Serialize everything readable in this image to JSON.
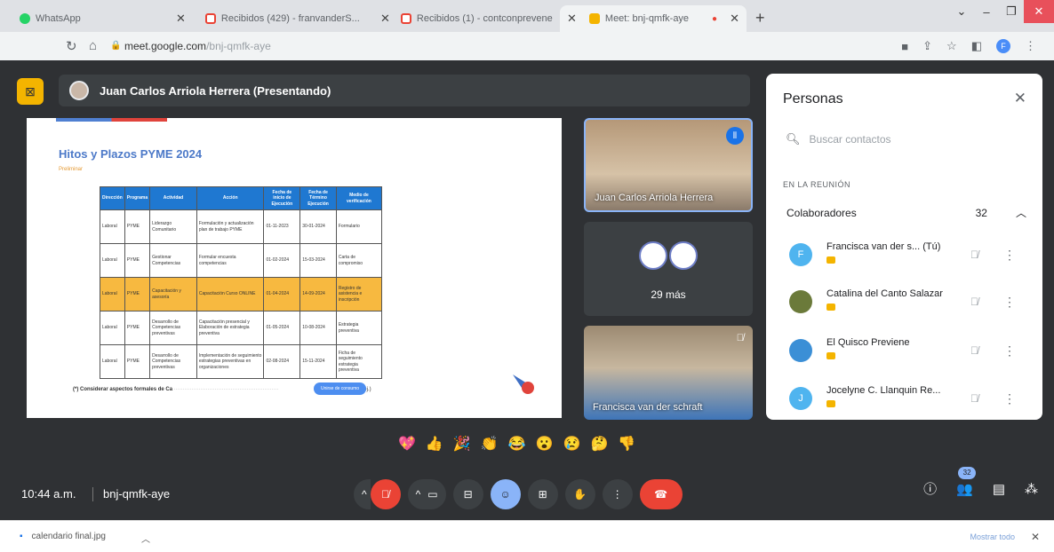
{
  "tabs": [
    {
      "label": "WhatsApp",
      "color": "#25d366"
    },
    {
      "label": "Recibidos (429) - franvanderS...",
      "color": "#ea4335"
    },
    {
      "label": "Recibidos (1) - contconprevene",
      "color": "#ea4335"
    },
    {
      "label": "Meet: bnj-qmfk-aye",
      "color": "#f4b400"
    }
  ],
  "address": {
    "host": "meet.google.com",
    "path": "/bnj-qmfk-aye"
  },
  "profile_initial": "F",
  "presenter": {
    "name": "Juan Carlos Arriola Herrera (Presentando)"
  },
  "slide": {
    "title": "Hitos y Plazos PYME 2024",
    "subtitle": "Preliminar",
    "columns": [
      "Dirección",
      "Programa",
      "Actividad",
      "Acción",
      "Fecha de inicio de Ejecución",
      "Fecha de Término Ejecución",
      "Medio de verificación"
    ],
    "rows": [
      [
        "Laboral",
        "PYME",
        "Liderazgo Comunitario",
        "Formulación y actualización plan de trabajo PYME",
        "01-11-2023",
        "30-01-2024",
        "Formulario"
      ],
      [
        "Laboral",
        "PYME",
        "Gestionar Competencias",
        "Formular encuesta competencias",
        "01-02-2024",
        "15-03-2024",
        "Carta de compromiso"
      ],
      [
        "Laboral",
        "PYME",
        "Capacitación y asesoría",
        "Capacitación Curso ONLINE",
        "01-04-2024",
        "14-09-2024",
        "Registro de asistencia e inscripción"
      ],
      [
        "Laboral",
        "PYME",
        "Desarrollo de Competencias preventivas",
        "Capacitación presencial y Elaboración de estrategia preventiva",
        "01-05-2024",
        "10-08-2024",
        "Estrategia preventiva"
      ],
      [
        "Laboral",
        "PYME",
        "Desarrollo de Competencias preventivas",
        "Implementación de seguimiento estrategias preventivas en organizaciones",
        "02-08-2024",
        "15-11-2024",
        "Ficha de seguimiento estrategia preventiva"
      ]
    ],
    "footnote_bold": "(*) Considerar aspectos formales de Ca",
    "footnote_end": "color, bot ej.)",
    "button": "Unirse de consumo"
  },
  "tiles": {
    "tile1_name": "Juan Carlos Arriola Herrera",
    "more_label": "29 más",
    "tile3_name": "Francisca van der schraft"
  },
  "people": {
    "title": "Personas",
    "search_placeholder": "Buscar contactos",
    "section": "EN LA REUNIÓN",
    "group": "Colaboradores",
    "count": "32",
    "members": [
      {
        "name": "Francisca van der s... (Tú)",
        "initial": "F",
        "color": "#4fb4ef"
      },
      {
        "name": "Catalina del Canto Salazar",
        "initial": "",
        "color": "#6b7a3a"
      },
      {
        "name": "El Quisco Previene",
        "initial": "",
        "color": "#3b8fd6"
      },
      {
        "name": "Jocelyne C. Llanquin Re...",
        "initial": "J",
        "color": "#4fb4ef"
      }
    ]
  },
  "reactions": [
    "💖",
    "👍",
    "🎉",
    "👏",
    "😂",
    "😮",
    "😢",
    "🤔",
    "👎"
  ],
  "bottom": {
    "time": "10:44 a.m.",
    "code": "bnj-qmfk-aye",
    "people_count": "32"
  },
  "downloads": {
    "file": "calendario final.jpg",
    "show_all": "Mostrar todo"
  }
}
